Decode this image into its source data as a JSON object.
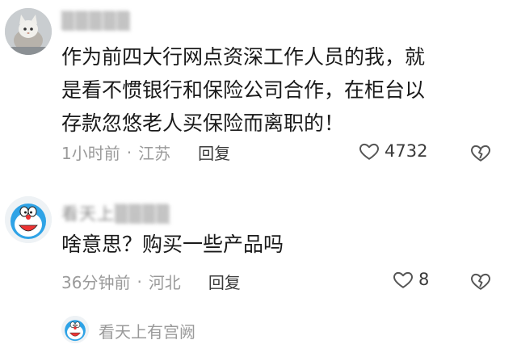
{
  "comments": [
    {
      "username": "▒▒▒▒▒",
      "text_lines": [
        "作为前四大行网点资深工作人员的我，就",
        "是看不惯银行和保险公司合作，在柜台以",
        "存款忽悠老人买保险而离职的！"
      ],
      "time": "1小时前",
      "location": "江苏",
      "reply_label": "回复",
      "likes": "4732",
      "avatar_icon": "cat-avatar-icon"
    },
    {
      "username": "看天上▒▒▒▒",
      "text_lines": [
        "啥意思？购买一些产品吗"
      ],
      "time": "36分钟前",
      "location": "河北",
      "reply_label": "回复",
      "likes": "8",
      "avatar_icon": "doraemon-avatar-icon"
    }
  ],
  "reply_box": {
    "placeholder": "看天上有宫阙",
    "avatar_icon": "doraemon-avatar-icon"
  },
  "separator": "·",
  "colors": {
    "text": "#1a1a1a",
    "meta": "#9a9a9a",
    "icon": "#555555"
  }
}
